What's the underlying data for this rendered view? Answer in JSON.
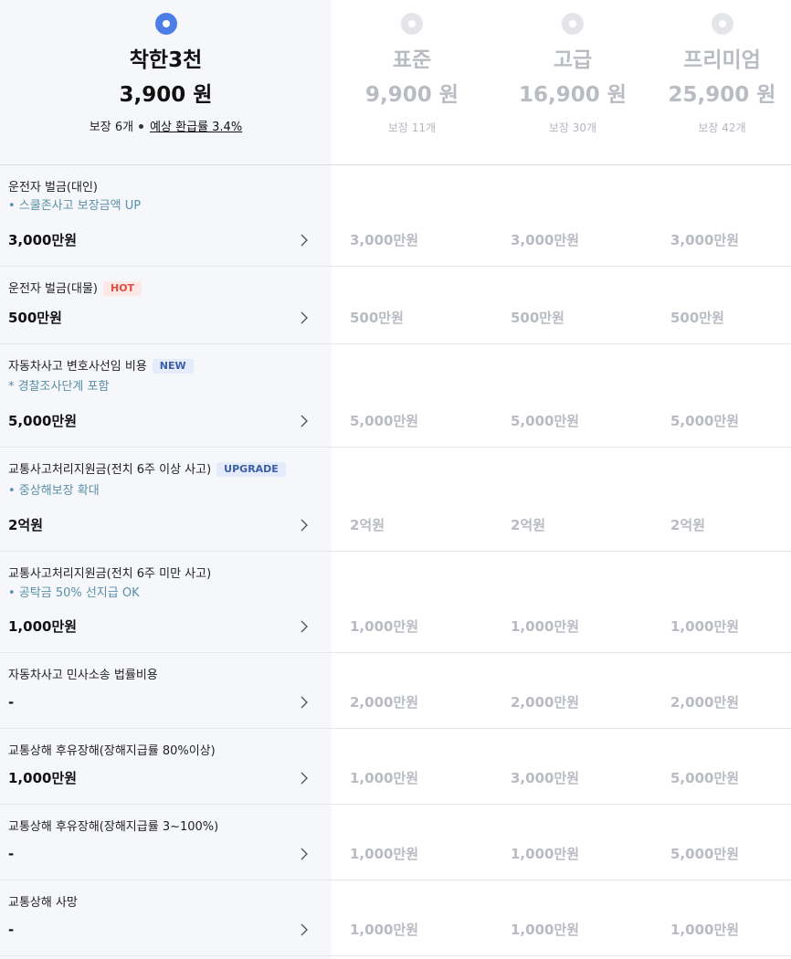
{
  "plans": [
    {
      "name": "착한3천",
      "price": "3,900 원",
      "coverage": "보장 6개",
      "refund": "예상 환급률 3.4%",
      "selected": true
    },
    {
      "name": "표준",
      "price": "9,900 원",
      "coverage": "보장 11개",
      "selected": false
    },
    {
      "name": "고급",
      "price": "16,900 원",
      "coverage": "보장 30개",
      "selected": false
    },
    {
      "name": "프리미엄",
      "price": "25,900 원",
      "coverage": "보장 42개",
      "selected": false
    }
  ],
  "rows": [
    {
      "title": "운전자 벌금(대인)",
      "sub": "• 스쿨존사고 보장금액 UP",
      "values": [
        "3,000만원",
        "3,000만원",
        "3,000만원",
        "3,000만원"
      ]
    },
    {
      "title": "운전자 벌금(대물)",
      "badge": "HOT",
      "values": [
        "500만원",
        "500만원",
        "500만원",
        "500만원"
      ]
    },
    {
      "title": "자동차사고 변호사선임 비용",
      "badge": "NEW",
      "sub": "* 경찰조사단계 포함",
      "values": [
        "5,000만원",
        "5,000만원",
        "5,000만원",
        "5,000만원"
      ]
    },
    {
      "title": "교통사고처리지원금(전치 6주 이상 사고)",
      "badge": "UPGRADE",
      "sub": "• 중상해보장 확대",
      "values": [
        "2억원",
        "2억원",
        "2억원",
        "2억원"
      ]
    },
    {
      "title": "교통사고처리지원금(전치 6주 미만 사고)",
      "sub": "• 공탁금 50% 선지급 OK",
      "values": [
        "1,000만원",
        "1,000만원",
        "1,000만원",
        "1,000만원"
      ]
    },
    {
      "title": "자동차사고 민사소송 법률비용",
      "values": [
        "-",
        "2,000만원",
        "2,000만원",
        "2,000만원"
      ]
    },
    {
      "title": "교통상해 후유장해(장해지급률 80%이상)",
      "values": [
        "1,000만원",
        "1,000만원",
        "3,000만원",
        "5,000만원"
      ]
    },
    {
      "title": "교통상해 후유장해(장해지급률 3~100%)",
      "values": [
        "-",
        "1,000만원",
        "1,000만원",
        "5,000만원"
      ]
    },
    {
      "title": "교통상해 사망",
      "values": [
        "-",
        "1,000만원",
        "1,000만원",
        "1,000만원"
      ]
    }
  ],
  "colors": {
    "accent": "#4d7ee8",
    "muted": "#b8bbc1",
    "subtext": "#5b8fa8",
    "hot": "#e24c3d"
  }
}
